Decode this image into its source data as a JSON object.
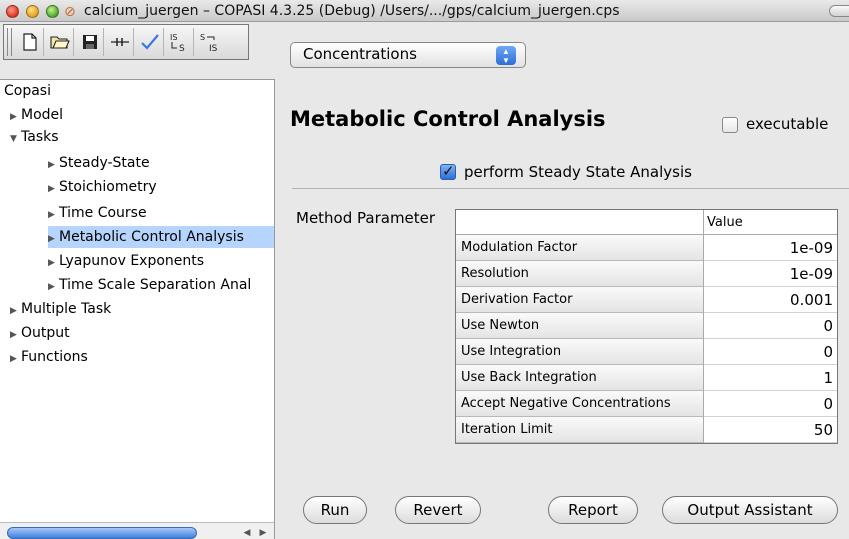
{
  "window": {
    "title": "calcium_juergen – COPASI 4.3.25 (Debug) /Users/.../gps/calcium_juergen.cps"
  },
  "toolbar": {
    "buttons": [
      "new-file-icon",
      "open-folder-icon",
      "save-disk-icon",
      "slider-icon",
      "check-icon",
      "independent-to-simple-icon",
      "simple-to-independent-icon"
    ],
    "view_select": {
      "selected": "Concentrations"
    }
  },
  "tree": {
    "root": "Copasi",
    "items": [
      {
        "label": "Model",
        "level": 1,
        "expanded": false
      },
      {
        "label": "Tasks",
        "level": 1,
        "expanded": true
      },
      {
        "label": "Steady-State",
        "level": 2,
        "expanded": false
      },
      {
        "label": "Stoichiometry",
        "level": 2,
        "expanded": false
      },
      {
        "label": "Time Course",
        "level": 2,
        "expanded": false
      },
      {
        "label": "Metabolic Control Analysis",
        "level": 2,
        "expanded": false,
        "selected": true
      },
      {
        "label": "Lyapunov Exponents",
        "level": 2,
        "expanded": false
      },
      {
        "label": "Time Scale Separation Anal",
        "level": 2,
        "expanded": false
      },
      {
        "label": "Multiple Task",
        "level": 1,
        "expanded": false
      },
      {
        "label": "Output",
        "level": 1,
        "expanded": false
      },
      {
        "label": "Functions",
        "level": 1,
        "expanded": false
      }
    ]
  },
  "main": {
    "title": "Metabolic Control Analysis",
    "executable": {
      "label": "executable",
      "checked": false
    },
    "steady_state": {
      "label": "perform Steady State Analysis",
      "checked": true
    },
    "method_label": "Method Parameter",
    "table": {
      "value_header": "Value",
      "rows": [
        {
          "name": "Modulation Factor",
          "value": "1e-09"
        },
        {
          "name": "Resolution",
          "value": "1e-09"
        },
        {
          "name": "Derivation Factor",
          "value": "0.001"
        },
        {
          "name": "Use Newton",
          "value": "0"
        },
        {
          "name": "Use Integration",
          "value": "0"
        },
        {
          "name": "Use Back Integration",
          "value": "1"
        },
        {
          "name": "Accept Negative Concentrations",
          "value": "0"
        },
        {
          "name": "Iteration Limit",
          "value": "50"
        }
      ]
    },
    "buttons": {
      "run": "Run",
      "revert": "Revert",
      "report": "Report",
      "output_assistant": "Output Assistant"
    }
  },
  "colors": {
    "selection": "#b5d5ff",
    "checkbox_accent": "#2e70d6"
  }
}
